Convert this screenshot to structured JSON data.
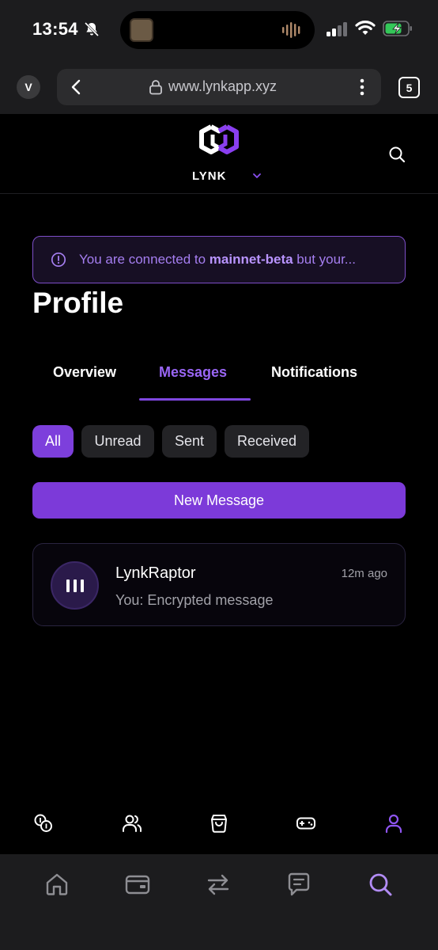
{
  "status_bar": {
    "time": "13:54",
    "battery_color": "#34c759"
  },
  "browser": {
    "avatar_letter": "V",
    "url": "www.lynkapp.xyz",
    "tab_count": "5"
  },
  "site_header": {
    "brand": "LYNK",
    "accent_color": "#7c3ad9"
  },
  "warning": {
    "prefix": "You are connected to ",
    "network": "mainnet-beta",
    "suffix": " but your..."
  },
  "page": {
    "title": "Profile"
  },
  "tabs": [
    {
      "label": "Overview",
      "active": false
    },
    {
      "label": "Messages",
      "active": true
    },
    {
      "label": "Notifications",
      "active": false
    }
  ],
  "filters": [
    {
      "label": "All",
      "active": true
    },
    {
      "label": "Unread",
      "active": false
    },
    {
      "label": "Sent",
      "active": false
    },
    {
      "label": "Received",
      "active": false
    }
  ],
  "new_message_label": "New Message",
  "messages": [
    {
      "name": "LynkRaptor",
      "time": "12m ago",
      "preview": "You: Encrypted message",
      "avatar_icon": "bars-icon"
    }
  ],
  "app_nav": [
    {
      "icon": "coins-icon",
      "active": false
    },
    {
      "icon": "users-icon",
      "active": false
    },
    {
      "icon": "shopping-bag-icon",
      "active": false
    },
    {
      "icon": "gamepad-icon",
      "active": false
    },
    {
      "icon": "user-icon",
      "active": true
    }
  ],
  "browser_toolbar": [
    {
      "icon": "home-icon",
      "active": false
    },
    {
      "icon": "wallet-icon",
      "active": false
    },
    {
      "icon": "swap-icon",
      "active": false
    },
    {
      "icon": "chat-icon",
      "active": false
    },
    {
      "icon": "search-icon",
      "active": true
    }
  ]
}
